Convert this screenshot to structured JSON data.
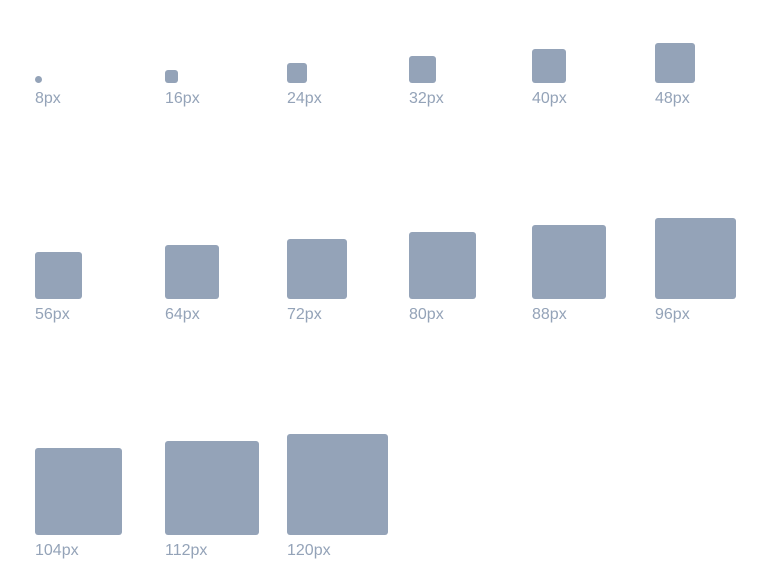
{
  "palette": {
    "swatch_color": "#94a3b8",
    "label_color": "#94a3b8"
  },
  "sizes": [
    {
      "label": "8px",
      "value": 8
    },
    {
      "label": "16px",
      "value": 16
    },
    {
      "label": "24px",
      "value": 24
    },
    {
      "label": "32px",
      "value": 32
    },
    {
      "label": "40px",
      "value": 40
    },
    {
      "label": "48px",
      "value": 48
    },
    {
      "label": "56px",
      "value": 56
    },
    {
      "label": "64px",
      "value": 64
    },
    {
      "label": "72px",
      "value": 72
    },
    {
      "label": "80px",
      "value": 80
    },
    {
      "label": "88px",
      "value": 88
    },
    {
      "label": "96px",
      "value": 96
    },
    {
      "label": "104px",
      "value": 104
    },
    {
      "label": "112px",
      "value": 112
    },
    {
      "label": "120px",
      "value": 120
    }
  ]
}
